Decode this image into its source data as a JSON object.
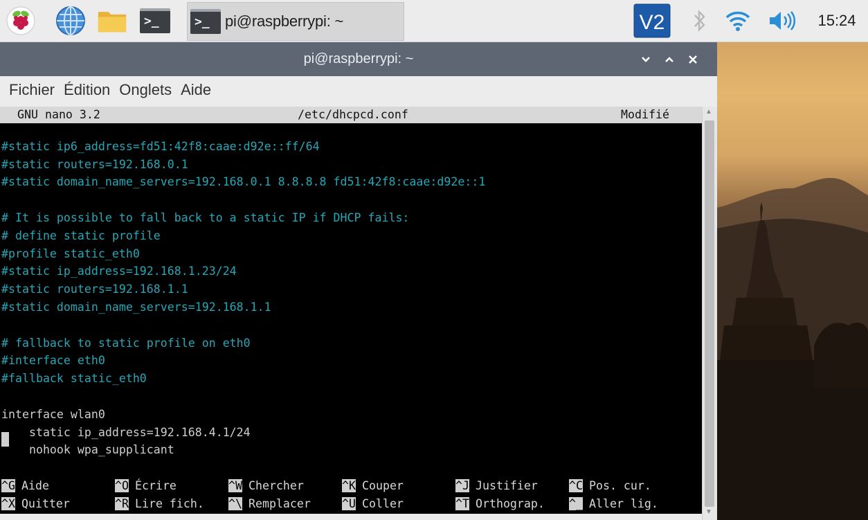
{
  "taskbar": {
    "launchers": [
      {
        "name": "raspberry-menu-icon"
      },
      {
        "name": "web-browser-icon"
      },
      {
        "name": "file-manager-icon"
      },
      {
        "name": "terminal-launcher-icon"
      }
    ],
    "active_task": {
      "label": "pi@raspberrypi: ~",
      "icon": "terminal-icon"
    },
    "tray": {
      "vnc_label": "V2",
      "icons": [
        "vnc-icon",
        "bluetooth-icon",
        "wifi-icon",
        "volume-icon"
      ],
      "clock": "15:24"
    }
  },
  "window": {
    "title": "pi@raspberrypi: ~",
    "controls": {
      "minimize": "⌄",
      "maximize": "⌃",
      "close": "✕"
    },
    "menu": [
      "Fichier",
      "Édition",
      "Onglets",
      "Aide"
    ]
  },
  "nano": {
    "header": {
      "version": "GNU nano 3.2",
      "filename": "/etc/dhcpcd.conf",
      "status": "Modifié"
    },
    "lines": [
      {
        "text": "",
        "style": "comment"
      },
      {
        "text": "#static ip6_address=fd51:42f8:caae:d92e::ff/64",
        "style": "comment"
      },
      {
        "text": "#static routers=192.168.0.1",
        "style": "comment"
      },
      {
        "text": "#static domain_name_servers=192.168.0.1 8.8.8.8 fd51:42f8:caae:d92e::1",
        "style": "comment"
      },
      {
        "text": "",
        "style": "comment"
      },
      {
        "text": "# It is possible to fall back to a static IP if DHCP fails:",
        "style": "comment"
      },
      {
        "text": "# define static profile",
        "style": "comment"
      },
      {
        "text": "#profile static_eth0",
        "style": "comment"
      },
      {
        "text": "#static ip_address=192.168.1.23/24",
        "style": "comment"
      },
      {
        "text": "#static routers=192.168.1.1",
        "style": "comment"
      },
      {
        "text": "#static domain_name_servers=192.168.1.1",
        "style": "comment"
      },
      {
        "text": "",
        "style": "comment"
      },
      {
        "text": "# fallback to static profile on eth0",
        "style": "comment"
      },
      {
        "text": "#interface eth0",
        "style": "comment"
      },
      {
        "text": "#fallback static_eth0",
        "style": "comment"
      },
      {
        "text": "",
        "style": "normal"
      },
      {
        "text": "interface wlan0",
        "style": "normal"
      },
      {
        "text": "    static ip_address=192.168.4.1/24",
        "style": "normal"
      },
      {
        "text": "    nohook wpa_supplicant",
        "style": "normal"
      },
      {
        "text": "",
        "style": "normal"
      }
    ],
    "shortcuts": [
      [
        {
          "key": "^G",
          "label": "Aide"
        },
        {
          "key": "^O",
          "label": "Écrire"
        },
        {
          "key": "^W",
          "label": "Chercher"
        },
        {
          "key": "^K",
          "label": "Couper"
        },
        {
          "key": "^J",
          "label": "Justifier"
        },
        {
          "key": "^C",
          "label": "Pos. cur."
        }
      ],
      [
        {
          "key": "^X",
          "label": "Quitter"
        },
        {
          "key": "^R",
          "label": "Lire fich."
        },
        {
          "key": "^\\",
          "label": "Remplacer"
        },
        {
          "key": "^U",
          "label": "Coller"
        },
        {
          "key": "^T",
          "label": "Orthograp."
        },
        {
          "key": "^_",
          "label": "Aller lig."
        }
      ]
    ]
  }
}
